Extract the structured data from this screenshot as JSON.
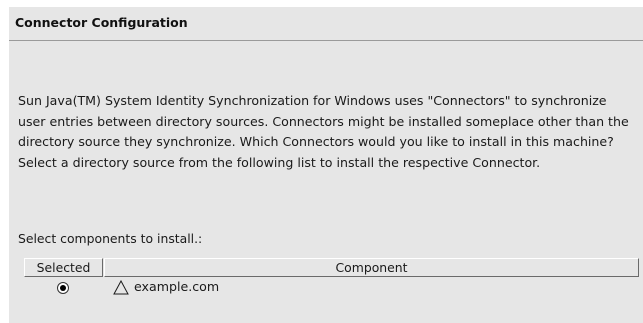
{
  "header": {
    "title": "Connector Configuration"
  },
  "main": {
    "description": "Sun Java(TM) System Identity Synchronization for Windows uses \"Connectors\" to synchronize user entries between directory sources. Connectors might be installed someplace other than the directory source they synchronize. Which Connectors would you like to install in this machine? Select a directory source from the following list to install the respective Connector.",
    "select_label": "Select components to install.:"
  },
  "table": {
    "columns": [
      "Selected",
      "Component"
    ],
    "rows": [
      {
        "selected": true,
        "icon": "warning-triangle-icon",
        "component": "example.com"
      }
    ]
  }
}
